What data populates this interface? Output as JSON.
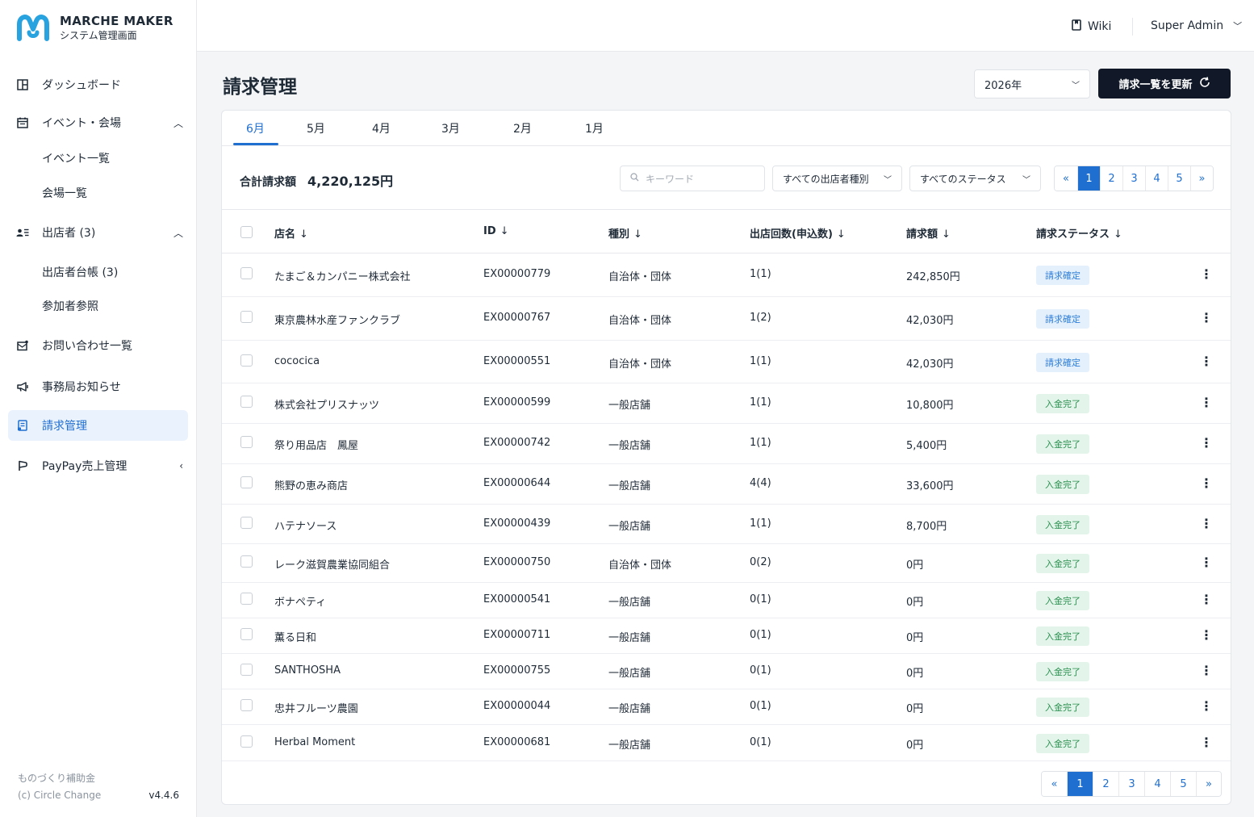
{
  "app": {
    "title": "MARCHE MAKER",
    "subtitle": "システム管理画面"
  },
  "sidebar": {
    "items": [
      {
        "label": "ダッシュボード",
        "icon": "dashboard-icon"
      },
      {
        "label": "イベント・会場",
        "icon": "calendar-icon"
      },
      {
        "label": "出店者 (3)",
        "icon": "vendors-icon"
      },
      {
        "label": "お問い合わせ一覧",
        "icon": "mail-icon"
      },
      {
        "label": "事務局お知らせ",
        "icon": "megaphone-icon"
      },
      {
        "label": "請求管理",
        "icon": "invoice-icon"
      },
      {
        "label": "PayPay売上管理",
        "icon": "paypay-icon"
      }
    ],
    "event_sub": [
      "イベント一覧",
      "会場一覧"
    ],
    "vendor_sub": [
      "出店者台帳 (3)",
      "参加者参照"
    ],
    "footer": {
      "line1": "ものづくり補助金",
      "copyright": "(c) Circle Change",
      "version": "v4.4.6"
    }
  },
  "topbar": {
    "wiki": "Wiki",
    "user": "Super Admin"
  },
  "page": {
    "title": "請求管理",
    "year": "2026年",
    "refresh_label": "請求一覧を更新"
  },
  "tabs": [
    "6月",
    "5月",
    "4月",
    "3月",
    "2月",
    "1月"
  ],
  "summary": {
    "label": "合計請求額",
    "value": "4,220,125円"
  },
  "filters": {
    "search_placeholder": "キーワード",
    "type": "すべての出店者種別",
    "status": "すべてのステータス"
  },
  "pagination": {
    "prev": "«",
    "next": "»",
    "pages": [
      "1",
      "2",
      "3",
      "4",
      "5"
    ],
    "current": "1"
  },
  "table": {
    "columns": [
      "店名",
      "ID",
      "種別",
      "出店回数(申込数)",
      "請求額",
      "請求ステータス"
    ],
    "sort_arrow": "↓",
    "rows": [
      {
        "name": "たまご＆カンパニー株式会社",
        "id": "EX00000779",
        "type": "自治体・団体",
        "count": "1(1)",
        "amount": "242,850円",
        "status": "請求確定"
      },
      {
        "name": "東京農林水産ファンクラブ",
        "id": "EX00000767",
        "type": "自治体・団体",
        "count": "1(2)",
        "amount": "42,030円",
        "status": "請求確定"
      },
      {
        "name": "cococica",
        "id": "EX00000551",
        "type": "自治体・団体",
        "count": "1(1)",
        "amount": "42,030円",
        "status": "請求確定"
      },
      {
        "name": "株式会社プリスナッツ",
        "id": "EX00000599",
        "type": "一般店舗",
        "count": "1(1)",
        "amount": "10,800円",
        "status": "入金完了"
      },
      {
        "name": "祭り用品店　鳳屋",
        "id": "EX00000742",
        "type": "一般店舗",
        "count": "1(1)",
        "amount": "5,400円",
        "status": "入金完了"
      },
      {
        "name": "熊野の恵み商店",
        "id": "EX00000644",
        "type": "一般店舗",
        "count": "4(4)",
        "amount": "33,600円",
        "status": "入金完了"
      },
      {
        "name": "ハテナソース",
        "id": "EX00000439",
        "type": "一般店舗",
        "count": "1(1)",
        "amount": "8,700円",
        "status": "入金完了"
      },
      {
        "name": "レーク滋賀農業協同組合",
        "id": "EX00000750",
        "type": "自治体・団体",
        "count": "0(2)",
        "amount": "0円",
        "status": "入金完了"
      },
      {
        "name": "ボナペティ",
        "id": "EX00000541",
        "type": "一般店舗",
        "count": "0(1)",
        "amount": "0円",
        "status": "入金完了"
      },
      {
        "name": "薫る日和",
        "id": "EX00000711",
        "type": "一般店舗",
        "count": "0(1)",
        "amount": "0円",
        "status": "入金完了"
      },
      {
        "name": "SANTHOSHA",
        "id": "EX00000755",
        "type": "一般店舗",
        "count": "0(1)",
        "amount": "0円",
        "status": "入金完了"
      },
      {
        "name": "忠井フルーツ農園",
        "id": "EX00000044",
        "type": "一般店舗",
        "count": "0(1)",
        "amount": "0円",
        "status": "入金完了"
      },
      {
        "name": "Herbal Moment",
        "id": "EX00000681",
        "type": "一般店舗",
        "count": "0(1)",
        "amount": "0円",
        "status": "入金完了"
      }
    ]
  },
  "colors": {
    "accent": "#1f6fd1",
    "dark_button": "#111827",
    "badge_confirm_bg": "#e5f0fd",
    "badge_paid_bg": "#e3f5ea"
  }
}
